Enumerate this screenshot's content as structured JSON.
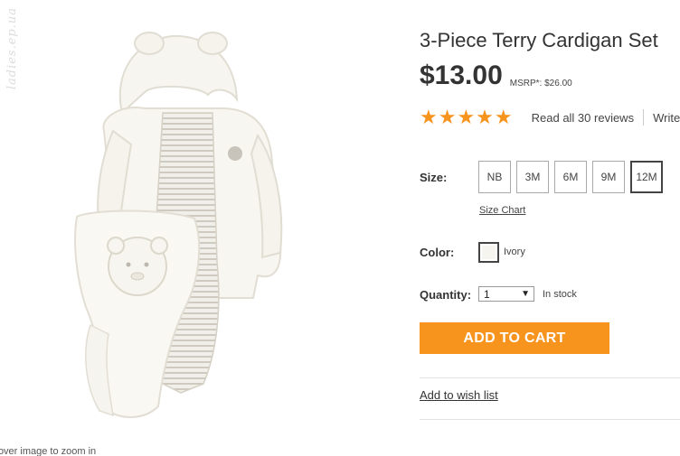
{
  "watermark": "ladies.ep.ua",
  "image": {
    "zoom_hint": "Hover image to zoom in"
  },
  "product": {
    "title": "3-Piece Terry Cardigan Set",
    "price": "$13.00",
    "msrp": "MSRP*: $26.00",
    "rating": {
      "stars": "★★★★★",
      "value": 5,
      "reviews_label": "Read all 30 reviews",
      "write_label": "Write"
    }
  },
  "size": {
    "label": "Size:",
    "options": [
      "NB",
      "3M",
      "6M",
      "9M",
      "12M"
    ],
    "selected": "12M",
    "chart_label": "Size Chart"
  },
  "color": {
    "label": "Color:",
    "name": "Ivory",
    "swatch": "#f6f4ee"
  },
  "quantity": {
    "label": "Quantity:",
    "value": "1",
    "arrow": "▼",
    "stock": "In stock"
  },
  "actions": {
    "add_to_cart": "ADD TO CART",
    "wishlist": "Add to wish list"
  },
  "colors": {
    "accent": "#f7941e",
    "text": "#333333"
  }
}
